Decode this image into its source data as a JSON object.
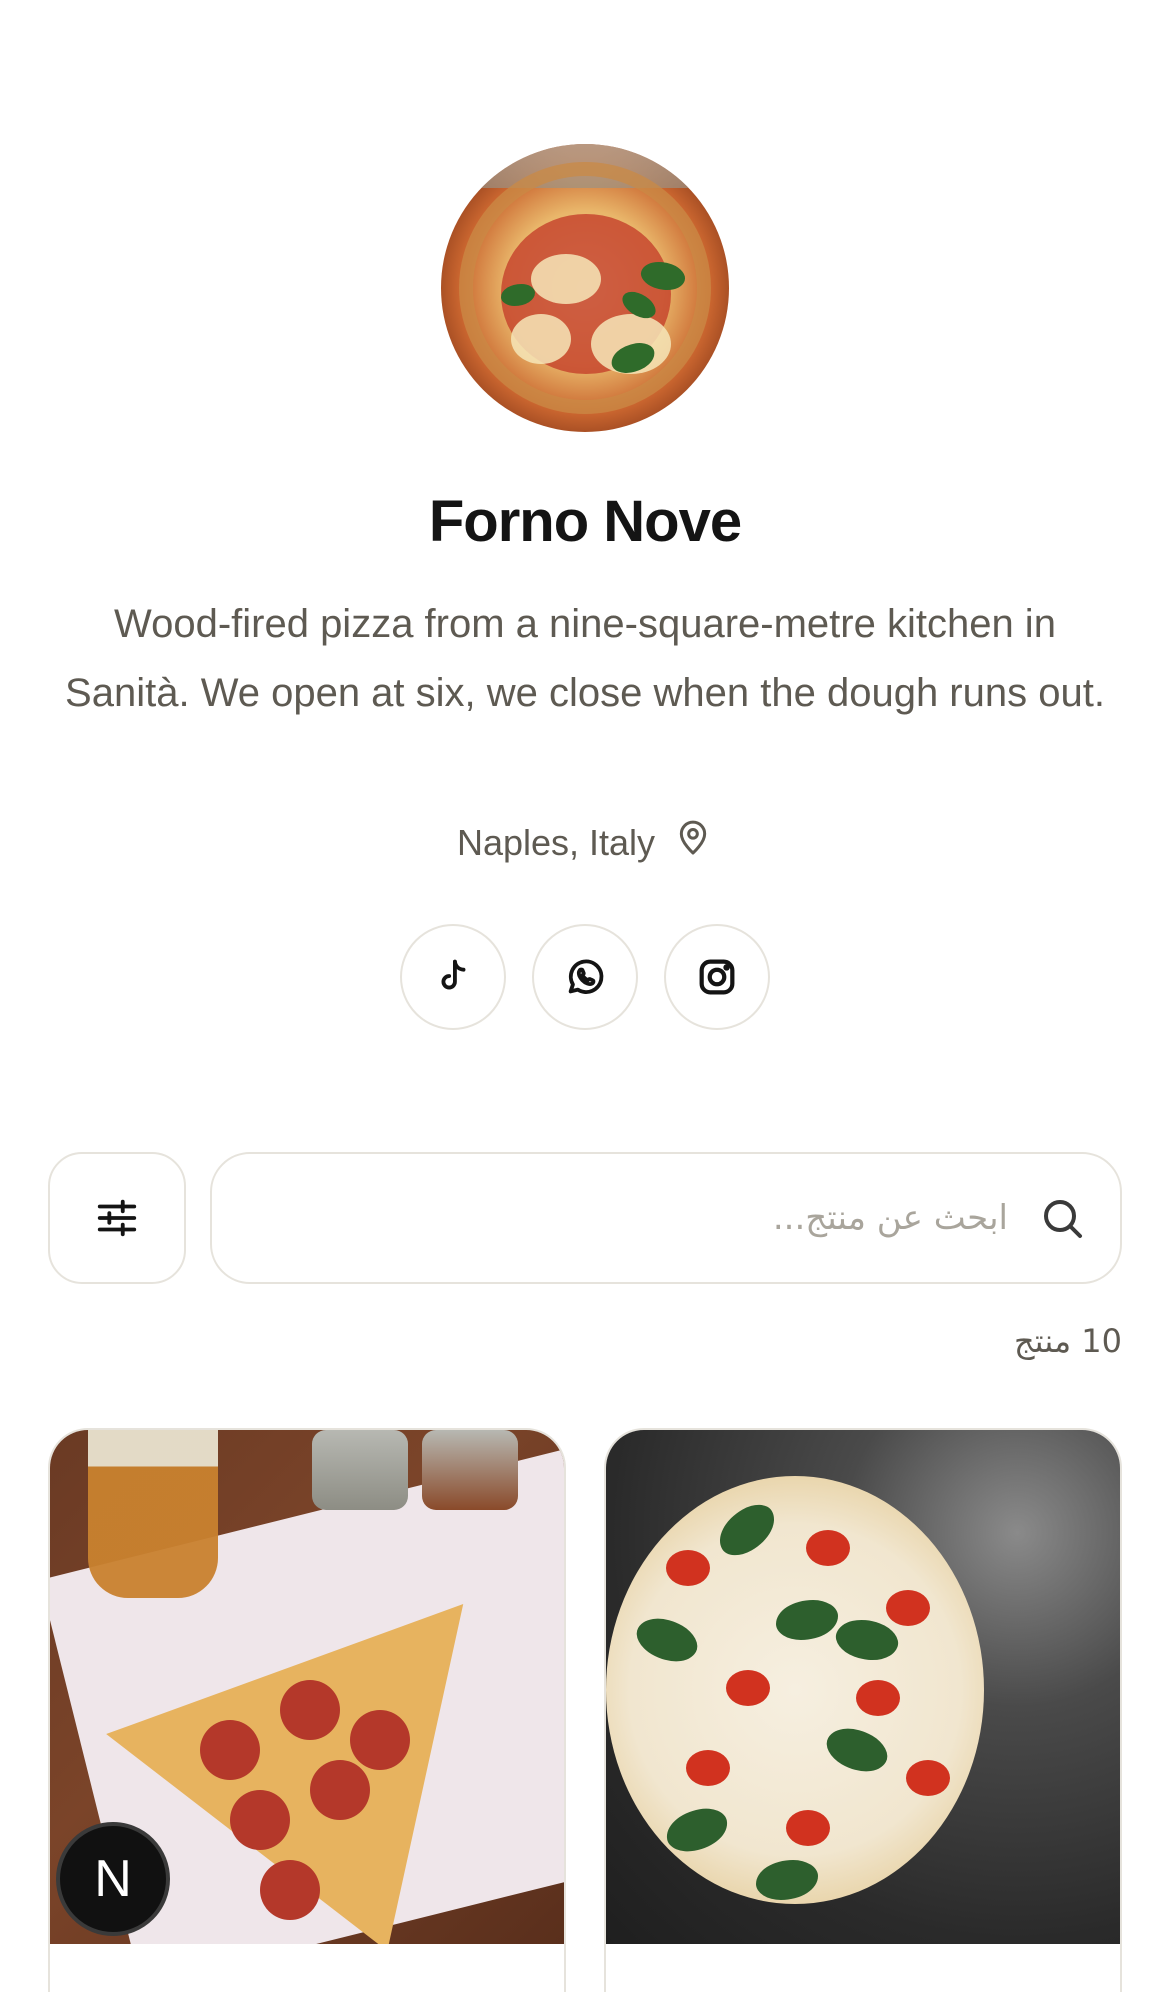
{
  "profile": {
    "name": "Forno Nove",
    "bio": "Wood-fired pizza from a nine-square-metre kitchen in Sanità. We open at six, we close when the dough runs out.",
    "location": "Naples, Italy"
  },
  "socials": [
    {
      "icon": "tiktok-icon"
    },
    {
      "icon": "whatsapp-icon"
    },
    {
      "icon": "instagram-icon"
    }
  ],
  "search": {
    "placeholder": "ابحث عن منتج...",
    "value": ""
  },
  "filter": {
    "icon": "sliders-icon"
  },
  "results": {
    "count_label": "10 منتج"
  },
  "products": [
    {
      "image": "pepperoni-slice-image"
    },
    {
      "image": "margherita-pizza-image"
    }
  ],
  "badge": {
    "letter": "N"
  },
  "colors": {
    "text": "#141414",
    "muted": "#5e5a52",
    "border": "#e6e3dc",
    "background": "#ffffff"
  }
}
